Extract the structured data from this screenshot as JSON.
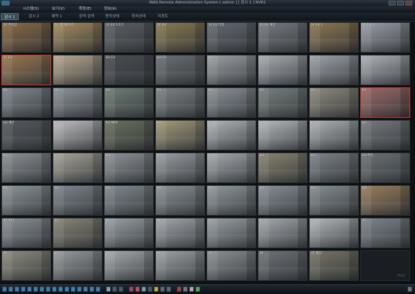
{
  "window": {
    "title": "iNAS Remote Administration System [ admin ] [ 감시 1 ] NVR1"
  },
  "menu": {
    "items": [
      "시스템(S)",
      "보기(V)",
      "확장(E)",
      "정보(A)"
    ]
  },
  "tabs": {
    "items": [
      "감시 1",
      "감시 2",
      "예약 1",
      "검색 검색",
      "동작상태",
      "장치상태",
      "리포트"
    ],
    "active_index": 0
  },
  "grid": {
    "columns": 8,
    "rows": 8,
    "cameras": [
      {
        "label": "1F 주차장",
        "tone": "#8a6a46",
        "alarm": false
      },
      {
        "label": "2F 엘리베이터",
        "tone": "#a48a5c",
        "alarm": false
      },
      {
        "label": "1F EV 1호기",
        "tone": "#5c5f63",
        "alarm": false
      },
      {
        "label": "2F EV",
        "tone": "#8a7a52",
        "alarm": false
      },
      {
        "label": "1F EV 터널",
        "tone": "#646a70",
        "alarm": false
      },
      {
        "label": "1F EV 계단",
        "tone": "#777b80",
        "alarm": false
      },
      {
        "label": "2F EV 1",
        "tone": "#8c7650",
        "alarm": false
      },
      {
        "label": "2F EV 2",
        "tone": "#9aa0a6",
        "alarm": false
      },
      {
        "label": "1F EV",
        "tone": "#9a7850",
        "alarm": true
      },
      {
        "label": "B1 EV",
        "tone": "#b9aa90",
        "alarm": false
      },
      {
        "label": "B2 EV",
        "tone": "#4a4d52",
        "alarm": false
      },
      {
        "label": "B3 EV",
        "tone": "#6b6e72",
        "alarm": false
      },
      {
        "label": "B4 EV",
        "tone": "#9ea2a6",
        "alarm": false
      },
      {
        "label": "B5 EV",
        "tone": "#a8adb2",
        "alarm": false
      },
      {
        "label": "B6 EV",
        "tone": "#9da3a9",
        "alarm": false
      },
      {
        "label": "B7 EV",
        "tone": "#aeb3b8",
        "alarm": false
      },
      {
        "label": "B1",
        "tone": "#7f878e",
        "alarm": false
      },
      {
        "label": "B1",
        "tone": "#8c9399",
        "alarm": false
      },
      {
        "label": "B1",
        "tone": "#6e7d76",
        "alarm": false
      },
      {
        "label": "B1",
        "tone": "#7c8285",
        "alarm": false
      },
      {
        "label": "B1",
        "tone": "#8c9398",
        "alarm": false
      },
      {
        "label": "B1",
        "tone": "#78817f",
        "alarm": false
      },
      {
        "label": "B1",
        "tone": "#908a7c",
        "alarm": false
      },
      {
        "label": "B1",
        "tone": "#9a6a66",
        "alarm": true
      },
      {
        "label": "B2 계단",
        "tone": "#565a5e",
        "alarm": false
      },
      {
        "label": "B2 계단",
        "tone": "#bfbfbf",
        "alarm": false
      },
      {
        "label": "B2 MDF",
        "tone": "#6a705e",
        "alarm": false
      },
      {
        "label": "B2",
        "tone": "#a39a7a",
        "alarm": false
      },
      {
        "label": "B2",
        "tone": "#b3b6b9",
        "alarm": false
      },
      {
        "label": "B2",
        "tone": "#b7babd",
        "alarm": false
      },
      {
        "label": "B2",
        "tone": "#b0b3b6",
        "alarm": false
      },
      {
        "label": "B2",
        "tone": "#767a7e",
        "alarm": false
      },
      {
        "label": "B3",
        "tone": "#8d9296",
        "alarm": false
      },
      {
        "label": "B3",
        "tone": "#a9a49a",
        "alarm": false
      },
      {
        "label": "B3",
        "tone": "#8f9498",
        "alarm": false
      },
      {
        "label": "B3",
        "tone": "#9a9fa3",
        "alarm": false
      },
      {
        "label": "B3",
        "tone": "#a6abaf",
        "alarm": false
      },
      {
        "label": "B3",
        "tone": "#8a8470",
        "alarm": false
      },
      {
        "label": "B3",
        "tone": "#7d8388",
        "alarm": false
      },
      {
        "label": "B3 주차",
        "tone": "#6c7276",
        "alarm": false
      },
      {
        "label": "B4",
        "tone": "#8e969b",
        "alarm": false
      },
      {
        "label": "B4",
        "tone": "#7e868c",
        "alarm": false
      },
      {
        "label": "B4",
        "tone": "#818a8f",
        "alarm": false
      },
      {
        "label": "B4",
        "tone": "#8b9397",
        "alarm": false
      },
      {
        "label": "B4",
        "tone": "#929a9e",
        "alarm": false
      },
      {
        "label": "B4",
        "tone": "#8a9297",
        "alarm": false
      },
      {
        "label": "B4",
        "tone": "#868e92",
        "alarm": false
      },
      {
        "label": "B4",
        "tone": "#9a7e5e",
        "alarm": false
      },
      {
        "label": "1F 로비",
        "tone": "#8b9196",
        "alarm": false
      },
      {
        "label": "1F",
        "tone": "#8a8676",
        "alarm": false
      },
      {
        "label": "1F",
        "tone": "#9ba1a5",
        "alarm": false
      },
      {
        "label": "1F",
        "tone": "#a3a8ac",
        "alarm": false
      },
      {
        "label": "1F",
        "tone": "#9aa0a4",
        "alarm": false
      },
      {
        "label": "1F",
        "tone": "#a5aaae",
        "alarm": false
      },
      {
        "label": "1F",
        "tone": "#b4b8bb",
        "alarm": false
      },
      {
        "label": "1F",
        "tone": "#7f868b",
        "alarm": false
      },
      {
        "label": "2F",
        "tone": "#8f8c80",
        "alarm": false
      },
      {
        "label": "2F",
        "tone": "#999c9e",
        "alarm": false
      },
      {
        "label": "2F",
        "tone": "#a7abad",
        "alarm": false
      },
      {
        "label": "2F",
        "tone": "#9fa3a6",
        "alarm": false
      },
      {
        "label": "2F",
        "tone": "#8d9194",
        "alarm": false
      },
      {
        "label": "2F",
        "tone": "#6f7377",
        "alarm": false
      },
      {
        "label": "2F 출입",
        "tone": "#787466",
        "alarm": false
      },
      {
        "label": "iNAS",
        "tone": "#1a1e22",
        "alarm": false,
        "empty": true
      }
    ]
  },
  "toolbar": {
    "buttons": [
      {
        "name": "layout-1-button",
        "color": "#3c7fb0"
      },
      {
        "name": "layout-4-button",
        "color": "#3c7fb0"
      },
      {
        "name": "layout-9-button",
        "color": "#3c7fb0"
      },
      {
        "name": "layout-16-button",
        "color": "#3c7fb0"
      },
      {
        "name": "layout-25-button",
        "color": "#3c7fb0"
      },
      {
        "name": "layout-36-button",
        "color": "#3c7fb0"
      },
      {
        "name": "layout-49-button",
        "color": "#3c7fb0"
      },
      {
        "name": "layout-64-button",
        "color": "#3c7fb0"
      },
      {
        "name": "layout-custom1-button",
        "color": "#3c7fb0"
      },
      {
        "name": "layout-custom2-button",
        "color": "#3c7fb0"
      },
      {
        "name": "layout-custom3-button",
        "color": "#3c7fb0"
      },
      {
        "name": "layout-custom4-button",
        "color": "#3c7fb0"
      },
      {
        "name": "layout-custom5-button",
        "color": "#3c7fb0"
      },
      {
        "name": "layout-custom6-button",
        "color": "#3c7fb0"
      },
      {
        "name": "layout-custom7-button",
        "color": "#3c7fb0"
      },
      {
        "name": "layout-custom8-button",
        "color": "#3c7fb0"
      },
      {
        "name": "sequence-button",
        "color": "#8aa0b4"
      },
      {
        "name": "prev-page-button",
        "color": "#4a5a68"
      },
      {
        "name": "next-page-button",
        "color": "#4a5a68"
      },
      {
        "name": "record-view-button",
        "color": "#b04060"
      },
      {
        "name": "alarm-button",
        "color": "#c05050"
      },
      {
        "name": "playback-button",
        "color": "#70a0c0"
      },
      {
        "name": "ptz-button",
        "color": "#4a5a68"
      },
      {
        "name": "snapshot-button",
        "color": "#d0a040"
      },
      {
        "name": "monitor-button",
        "color": "#5a6a78"
      },
      {
        "name": "audio-button",
        "color": "#5a6a78"
      },
      {
        "name": "settings-button",
        "color": "#b04040"
      },
      {
        "name": "info-button",
        "color": "#6a7a88"
      },
      {
        "name": "chat-button",
        "color": "#c0a0b0"
      },
      {
        "name": "status-button",
        "color": "#50b050"
      },
      {
        "name": "exit-button",
        "color": "#707a84"
      }
    ]
  }
}
